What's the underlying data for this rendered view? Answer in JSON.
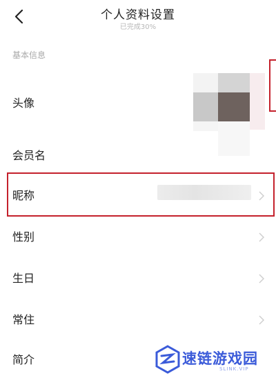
{
  "header": {
    "title": "个人资料设置",
    "subtitle": "已完成30%",
    "back_icon": "chevron-left-icon"
  },
  "section": {
    "label": "基本信息"
  },
  "rows": [
    {
      "label": "头像"
    },
    {
      "label": "会员名"
    },
    {
      "label": "昵称"
    },
    {
      "label": "性别"
    },
    {
      "label": "生日"
    },
    {
      "label": "常住"
    },
    {
      "label": "简介"
    }
  ],
  "colors": {
    "highlight_border": "#c4202b",
    "watermark_blue": "#3b5bd9"
  },
  "watermark": {
    "text": "速链游戏园",
    "sub": "SLINK.VIP"
  }
}
